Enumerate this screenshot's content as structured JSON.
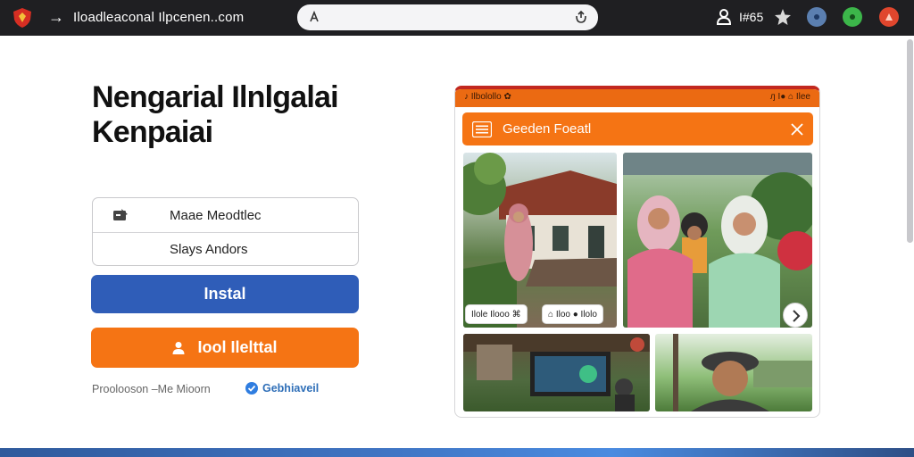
{
  "browser": {
    "site_url": "Iloadleaconal Ilpcenen..com",
    "user_count": "I#65",
    "icons": [
      "shield-logo-icon",
      "back-arrow-icon",
      "address-lock-icon",
      "address-reload-icon",
      "user-icon",
      "star-icon",
      "globe-icon",
      "green-dot-icon",
      "red-profile-icon"
    ]
  },
  "hero": {
    "headline_line1": "Nengarial Ilnlgalai",
    "headline_line2": "Kenpaiai"
  },
  "options": {
    "label_1": "Maae Meodtlec",
    "label_2": "Slays Andors"
  },
  "buttons": {
    "install_label": "Instal",
    "secondary_label": "Iool Ilelttal"
  },
  "footer": {
    "note": "Proolooson –Me Mioorn",
    "verified_label": "Gebhiaveil"
  },
  "phone": {
    "status_left": "♪ Ilbolollo ✿",
    "status_right": "ԓ I● ⌂ Ilee",
    "app_title": "Geeden Foeatl",
    "captions": [
      "Ilole  Ilooo  ⌘",
      "⌂  Iloo  ●  Ilolo"
    ]
  },
  "colors": {
    "topbar": "#1f1f22",
    "install_blue": "#2f5db8",
    "accent_orange": "#f57414",
    "header_red": "#c2281f"
  }
}
